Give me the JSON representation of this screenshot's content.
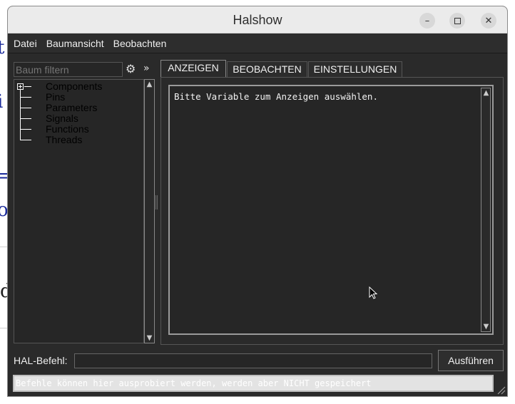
{
  "window": {
    "title": "Halshow",
    "controls": [
      "minimize-icon",
      "maximize-icon",
      "close-icon"
    ]
  },
  "menu": {
    "items": [
      "Datei",
      "Baumansicht",
      "Beobachten"
    ]
  },
  "tree_panel": {
    "filter_placeholder": "Baum filtern",
    "filter_value": "",
    "items": [
      "Components",
      "Pins",
      "Parameters",
      "Signals",
      "Functions",
      "Threads"
    ]
  },
  "tabs": [
    {
      "label": "ANZEIGEN",
      "active": true
    },
    {
      "label": "BEOBACHTEN",
      "active": false
    },
    {
      "label": "EINSTELLUNGEN",
      "active": false
    }
  ],
  "display": {
    "text": "Bitte Variable zum Anzeigen auswählen."
  },
  "command": {
    "label": "HAL-Befehl:",
    "value": "",
    "run_button": "Ausführen",
    "hint": "Befehle können hier ausprobiert werden, werden aber NICHT gespeichert"
  },
  "colors": {
    "window_bg": "#2a2a2a",
    "titlebar_bg": "#ebebeb",
    "text": "#f0f0f0"
  }
}
